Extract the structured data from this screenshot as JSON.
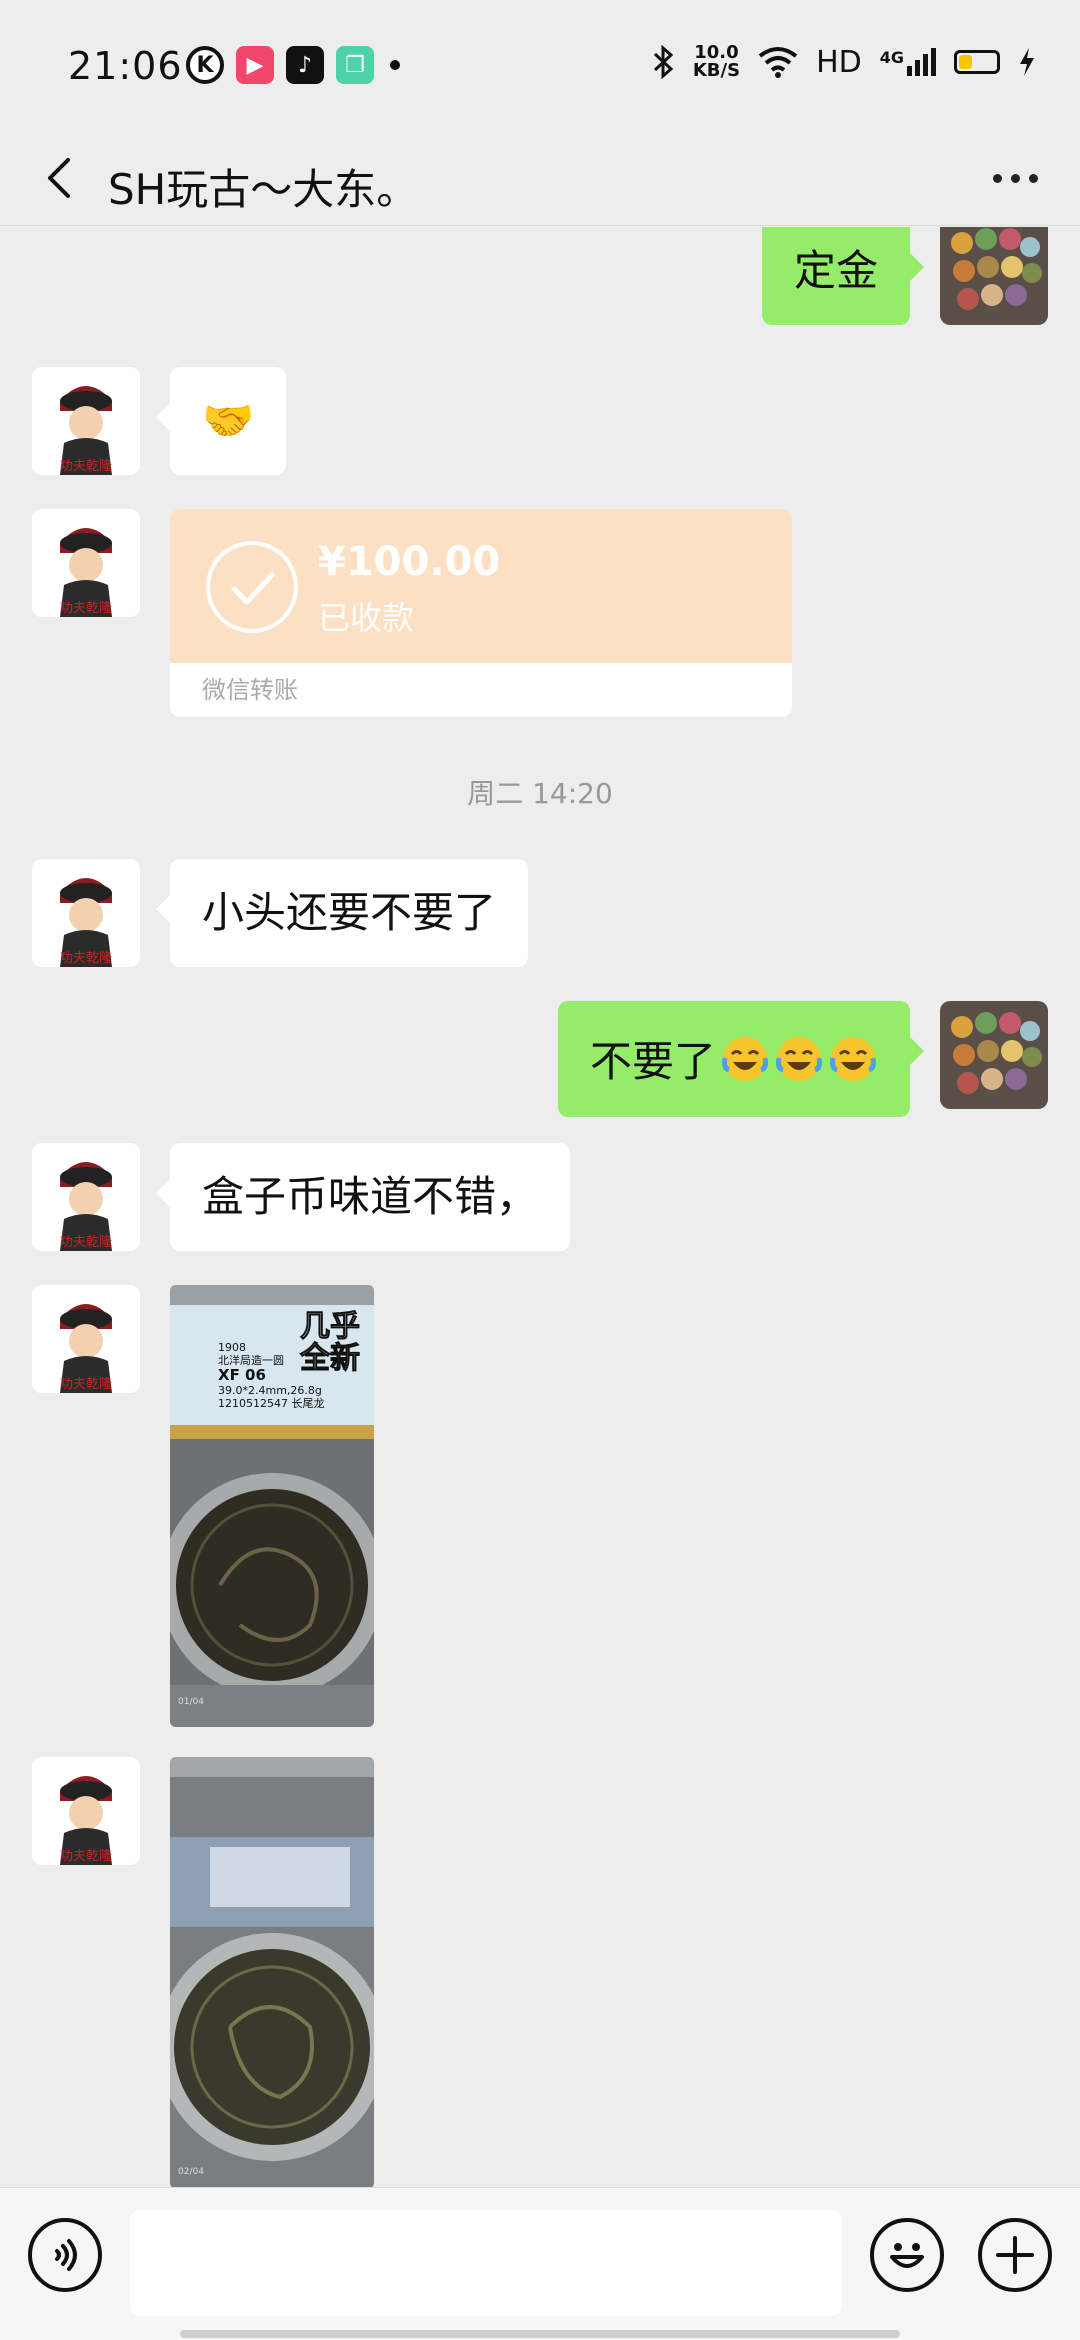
{
  "status_bar": {
    "time": "21:06",
    "app_icons": [
      "K",
      "▶",
      "♪",
      "❐"
    ],
    "net_speed_top": "10.0",
    "net_speed_bottom": "KB/S",
    "hd": "HD",
    "network": "4G",
    "battery_level": 0.35,
    "battery_color": "#f6c700"
  },
  "header": {
    "back_icon": "chevron-left-icon",
    "title": "SH玩古～大东。",
    "more_icon": "more-dots-icon"
  },
  "messages": {
    "m1": {
      "direction": "out",
      "text": "定金"
    },
    "m2": {
      "direction": "in",
      "text": "🤝"
    },
    "m3": {
      "direction": "in",
      "type": "transfer",
      "amount": "¥100.00",
      "status": "已收款",
      "footer": "微信转账"
    },
    "timestamp": "周二 14:20",
    "m4": {
      "direction": "in",
      "text": "小头还要不要了"
    },
    "m5": {
      "direction": "out",
      "text": "不要了"
    },
    "m6": {
      "direction": "in",
      "text": "盒子币味道不错，"
    },
    "m7": {
      "direction": "in",
      "type": "image",
      "overlay_lines": [
        "1908",
        "北洋局造一圆",
        "XF 06",
        "39.0*2.4mm,26.8g",
        "1210512547 长尾龙"
      ],
      "headline": "几乎全新",
      "page": "01/04"
    },
    "m8": {
      "direction": "in",
      "type": "image",
      "page": "02/04"
    }
  },
  "input_bar": {
    "voice_icon": "voice-icon",
    "placeholder": "",
    "emoji_icon": "emoji-icon",
    "plus_icon": "plus-icon"
  },
  "colors": {
    "background": "#ededed",
    "bubble_out": "#95ec69",
    "bubble_in": "#ffffff",
    "transfer": "#fde0c4"
  }
}
